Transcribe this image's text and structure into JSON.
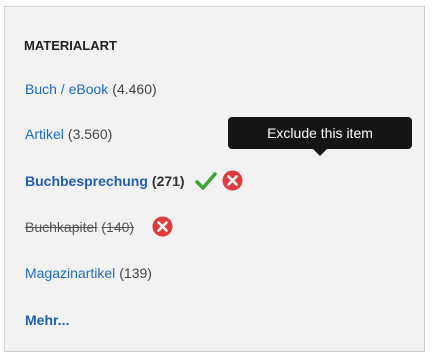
{
  "facet": {
    "heading": "MATERIALART",
    "items": [
      {
        "label": "Buch / eBook",
        "count": "(4.460)",
        "state": "normal"
      },
      {
        "label": "Artikel",
        "count": "(3.560)",
        "state": "normal"
      },
      {
        "label": "Buchbesprechung",
        "count": "(271)",
        "state": "active"
      },
      {
        "label": "Buchkapitel",
        "count": "(140)",
        "state": "excluded"
      },
      {
        "label": "Magazinartikel",
        "count": "(139)",
        "state": "normal"
      }
    ],
    "more_label": "Mehr..."
  },
  "tooltip": {
    "text": "Exclude this item"
  },
  "icons": {
    "include": "check-icon",
    "exclude": "x-circle-icon"
  },
  "colors": {
    "link": "#1a6bc4",
    "check": "#3aa43a",
    "exclude": "#e03a3a",
    "tooltip_bg": "#151515"
  }
}
